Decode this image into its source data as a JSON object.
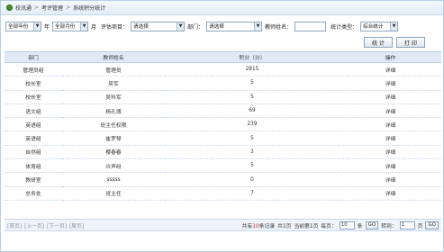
{
  "breadcrumb": {
    "items": [
      "校讯通",
      "考评管理",
      "系统积分统计"
    ],
    "separator": ">"
  },
  "filters": {
    "year": "全部年份",
    "year_unit": "年",
    "month": "全部月份",
    "month_unit": "月",
    "eval_label": "评估项目：",
    "eval_value": "请选择",
    "dept_label": "部门：",
    "dept_value": "请选择",
    "teacher_label": "教师姓名：",
    "teacher_value": "",
    "stat_label": "统计类型：",
    "stat_value": "综合统计"
  },
  "buttons": {
    "stat": "统 计",
    "print": "打 印"
  },
  "table": {
    "headers": [
      "部门",
      "教师姓名",
      "积分（分）",
      "操作"
    ],
    "rows": [
      [
        "管理员组",
        "管理员",
        "2815",
        "详细"
      ],
      [
        "校长室",
        "吴军",
        "5",
        "详细"
      ],
      [
        "校长室",
        "吴科军",
        "5",
        "详细"
      ],
      [
        "语文组",
        "杨孔博",
        "69",
        "详细"
      ],
      [
        "英语组",
        "班主任权限",
        "239",
        "详细"
      ],
      [
        "英语组",
        "崔罗琴",
        "5",
        "详细"
      ],
      [
        "自然组",
        "樱春春",
        "3",
        "详细"
      ],
      [
        "体育组",
        "许声纷",
        "5",
        "详细"
      ],
      [
        "教研室",
        "sssss",
        "0",
        "详细"
      ],
      [
        "总务处",
        "班主任",
        "7",
        "详细"
      ]
    ]
  },
  "pager": {
    "links": [
      "[首页]",
      "[上一页]",
      "[下一页]",
      "[尾页]"
    ],
    "total_prefix": "共有",
    "total_count": "10",
    "total_suffix": "条记录",
    "pages_prefix": "共",
    "pages_count": "1",
    "pages_suffix": "页",
    "current_prefix": "当前第",
    "current_page": "1",
    "current_suffix": "页",
    "per_page_label": "每页：",
    "per_page_value": "10",
    "per_page_unit": "条",
    "go1": "GO",
    "jump_label": "转到：",
    "jump_value": "1",
    "jump_unit": "页",
    "go2": "GO"
  }
}
